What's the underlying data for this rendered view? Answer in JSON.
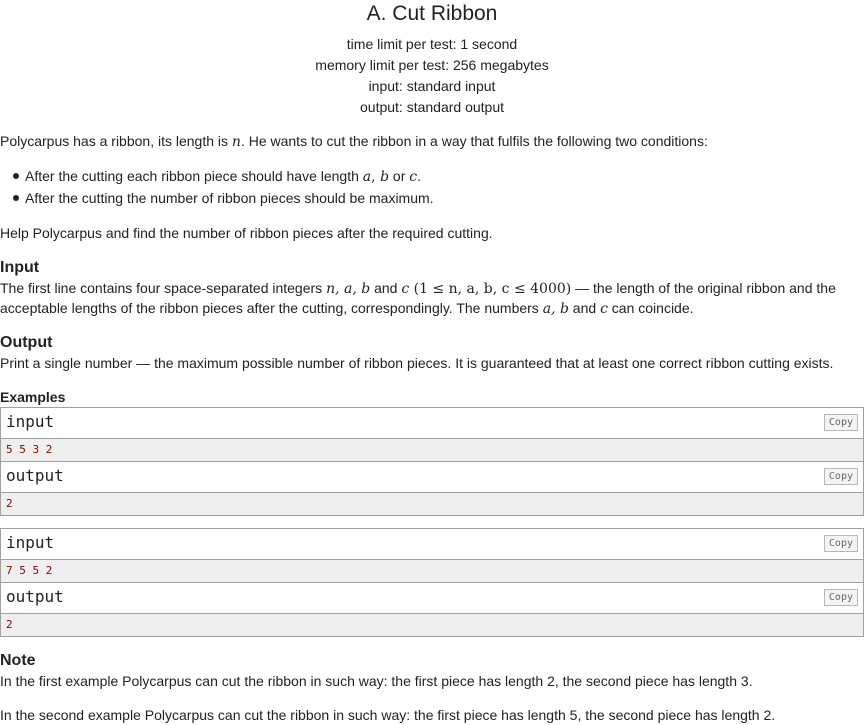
{
  "problem": {
    "title": "A. Cut Ribbon",
    "time_limit": "time limit per test: 1 second",
    "memory_limit": "memory limit per test: 256 megabytes",
    "input_file": "input: standard input",
    "output_file": "output: standard output"
  },
  "statement": {
    "p1_a": "Polycarpus has a ribbon, its length is ",
    "p1_var": "n",
    "p1_b": ". He wants to cut the ribbon in a way that fulfils the following two conditions:",
    "li1_a": "After the cutting each ribbon piece should have length ",
    "li1_var_a": "a",
    "li1_comma": ", ",
    "li1_var_b": "b",
    "li1_or": " or ",
    "li1_var_c": "c",
    "li1_end": ".",
    "li2": "After the cutting the number of ribbon pieces should be maximum.",
    "p2": "Help Polycarpus and find the number of ribbon pieces after the required cutting."
  },
  "input_section": {
    "title": "Input",
    "l1_a": "The first line contains four space-separated integers ",
    "l1_vars": "n, a, b",
    "l1_and": " and ",
    "l1_c": "c",
    "l1_constraint": " (1 ≤ n, a, b, c ≤ 4000)",
    "l1_b": " — the length of the original ribbon and the",
    "l2_a": "acceptable lengths of the ribbon pieces after the cutting, correspondingly. The numbers ",
    "l2_vars": "a, b",
    "l2_and": " and ",
    "l2_c": "c",
    "l2_b": " can coincide."
  },
  "output_section": {
    "title": "Output",
    "text": "Print a single number — the maximum possible number of ribbon pieces. It is guaranteed that at least one correct ribbon cutting exists."
  },
  "examples": {
    "title": "Examples",
    "copy_label": "Copy",
    "input_label": "input",
    "output_label": "output",
    "tests": [
      {
        "input": "5 5 3 2",
        "output": "2"
      },
      {
        "input": "7 5 5 2",
        "output": "2"
      }
    ]
  },
  "note": {
    "title": "Note",
    "p1": "In the first example Polycarpus can cut the ribbon in such way: the first piece has length 2, the second piece has length 3.",
    "p2": "In the second example Polycarpus can cut the ribbon in such way: the first piece has length 5, the second piece has length 2."
  }
}
